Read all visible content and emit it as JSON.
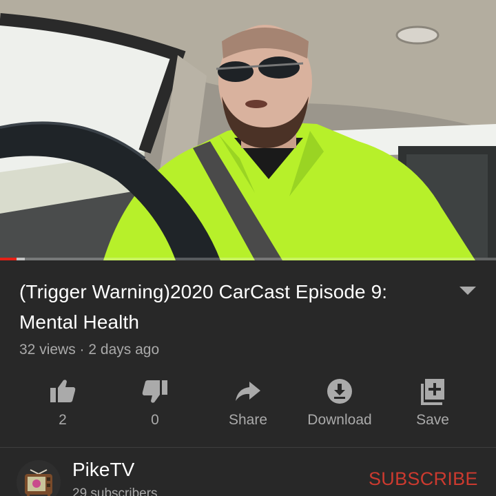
{
  "player": {
    "progress_fraction": 0.034,
    "buffer_fraction": 0.05,
    "colors": {
      "progress": "#e62117"
    }
  },
  "video": {
    "title": "(Trigger Warning)2020 CarCast Episode 9: Mental Health",
    "views": "32 views",
    "separator": "·",
    "age": "2 days ago"
  },
  "actions": [
    {
      "icon": "thumbs-up-icon",
      "label": "2"
    },
    {
      "icon": "thumbs-down-icon",
      "label": "0"
    },
    {
      "icon": "share-icon",
      "label": "Share"
    },
    {
      "icon": "download-icon",
      "label": "Download"
    },
    {
      "icon": "save-to-playlist-icon",
      "label": "Save"
    }
  ],
  "channel": {
    "name": "PikeTV",
    "subscribers": "29 subscribers",
    "subscribe_label": "SUBSCRIBE",
    "subscribe_color": "#cc3a2f"
  }
}
